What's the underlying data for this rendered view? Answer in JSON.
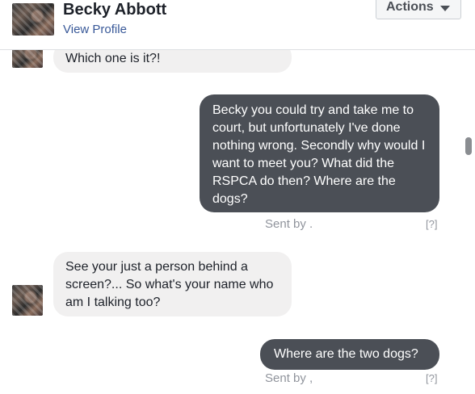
{
  "header": {
    "contact_name": "Becky Abbott",
    "view_profile_label": "View Profile",
    "actions_label": "Actions"
  },
  "messages": [
    {
      "direction": "incoming",
      "text": "Which one is it?!"
    },
    {
      "direction": "outgoing",
      "text": "Becky you could try and take me to court, but unfortunately I've done nothing wrong. Secondly why would I want to meet you? What did the RSPCA do then? Where are the dogs?",
      "sent_by": "Sent by .",
      "help": "[?]"
    },
    {
      "direction": "incoming",
      "text": "See your just a person behind a screen?... So what's your name who am I talking too?"
    },
    {
      "direction": "outgoing",
      "text": "Where are the two dogs?",
      "sent_by": "Sent by ,",
      "help": "[?]"
    }
  ],
  "colors": {
    "outgoing_bubble": "#4b4f56",
    "incoming_bubble": "#f1f0f0",
    "link": "#385898"
  },
  "icons": {
    "actions_caret": "caret-down-icon",
    "avatar": "profile-photo"
  }
}
